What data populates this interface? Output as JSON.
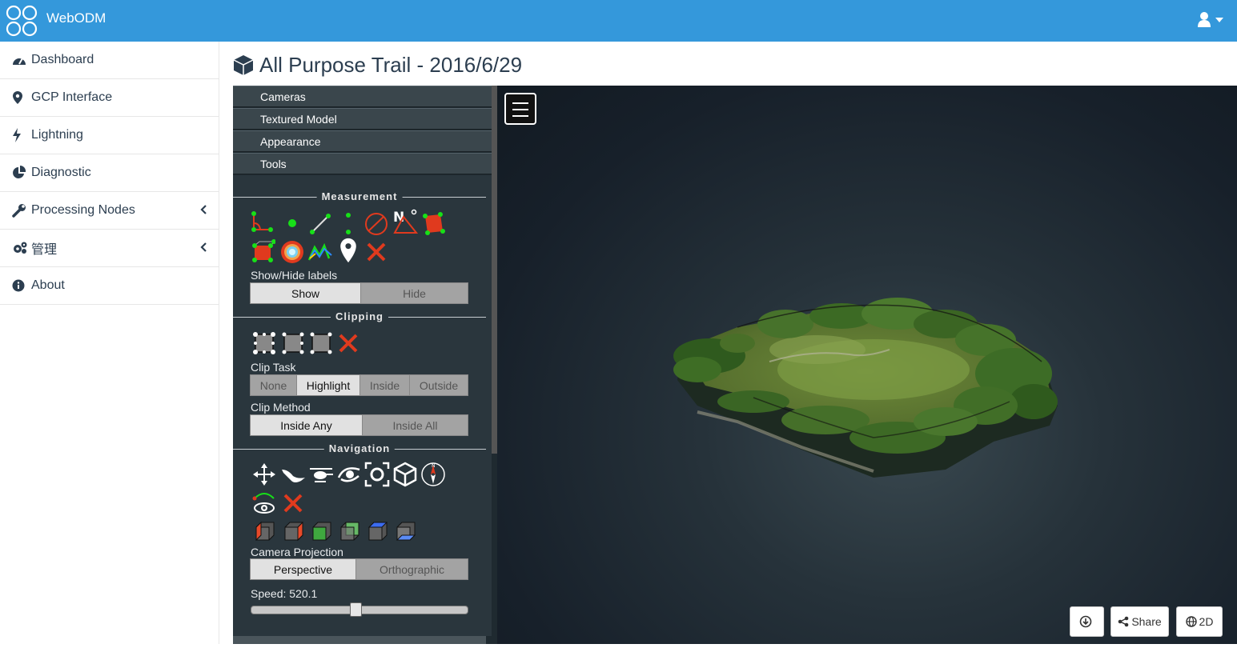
{
  "app": {
    "brand": "WebODM",
    "logo_icon": "webodm-logo-icon",
    "user_icon": "user-icon"
  },
  "sidebar": {
    "items": [
      {
        "label": "Dashboard",
        "icon": "dashboard-icon"
      },
      {
        "label": "GCP Interface",
        "icon": "map-marker-icon"
      },
      {
        "label": "Lightning",
        "icon": "bolt-icon"
      },
      {
        "label": "Diagnostic",
        "icon": "pie-chart-icon"
      },
      {
        "label": "Processing Nodes",
        "icon": "wrench-icon",
        "has_submenu": true
      },
      {
        "label": "管理",
        "icon": "gears-icon",
        "has_submenu": true
      },
      {
        "label": "About",
        "icon": "info-circle-icon"
      }
    ]
  },
  "page": {
    "title": "All Purpose Trail - 2016/6/29",
    "title_icon": "cube-icon"
  },
  "panel": {
    "accordion": [
      "Cameras",
      "Textured Model",
      "Appearance",
      "Tools"
    ],
    "measurement": {
      "heading": "Measurement",
      "tools": [
        "angle-measure-icon",
        "point-measure-icon",
        "distance-measure-icon",
        "height-measure-icon",
        "circle-measure-icon",
        "azimuth-measure-icon",
        "area-measure-icon",
        "volume-measure-icon",
        "sphere-volume-icon",
        "height-profile-icon",
        "annotation-icon",
        "remove-measurements-icon"
      ],
      "labels_caption": "Show/Hide labels",
      "labels_options": [
        "Show",
        "Hide"
      ],
      "labels_selected": "Show"
    },
    "clipping": {
      "heading": "Clipping",
      "tools": [
        "clip-volume-icon",
        "clip-polygon-icon",
        "clip-screen-box-icon",
        "remove-clipping-icon"
      ],
      "task_caption": "Clip Task",
      "task_options": [
        "None",
        "Highlight",
        "Inside",
        "Outside"
      ],
      "task_selected": "Highlight",
      "method_caption": "Clip Method",
      "method_options": [
        "Inside Any",
        "Inside All"
      ],
      "method_selected": "Inside Any"
    },
    "navigation": {
      "heading": "Navigation",
      "controls": [
        "earth-controls-icon",
        "fps-controls-icon",
        "helicopter-controls-icon",
        "orbit-controls-icon",
        "focus-icon",
        "navigation-cube-icon",
        "compass-icon",
        "camera-animation-icon",
        "remove-animation-icon"
      ],
      "views": [
        "left-view-icon",
        "right-view-icon",
        "front-view-icon",
        "back-view-icon",
        "top-view-icon",
        "bottom-view-icon"
      ],
      "projection_caption": "Camera Projection",
      "projection_options": [
        "Perspective",
        "Orthographic"
      ],
      "projection_selected": "Perspective",
      "speed_label": "Speed: 520.1",
      "speed_fraction": 0.48
    }
  },
  "viewport": {
    "menu_icon": "hamburger-menu-icon",
    "buttons": {
      "download_icon": "download-icon",
      "share": "Share",
      "view2d": "2D"
    }
  },
  "colors": {
    "navbar": "#3498db",
    "panel": "#2a363d",
    "accent_red": "#e03a1e",
    "accent_green": "#17e018"
  }
}
